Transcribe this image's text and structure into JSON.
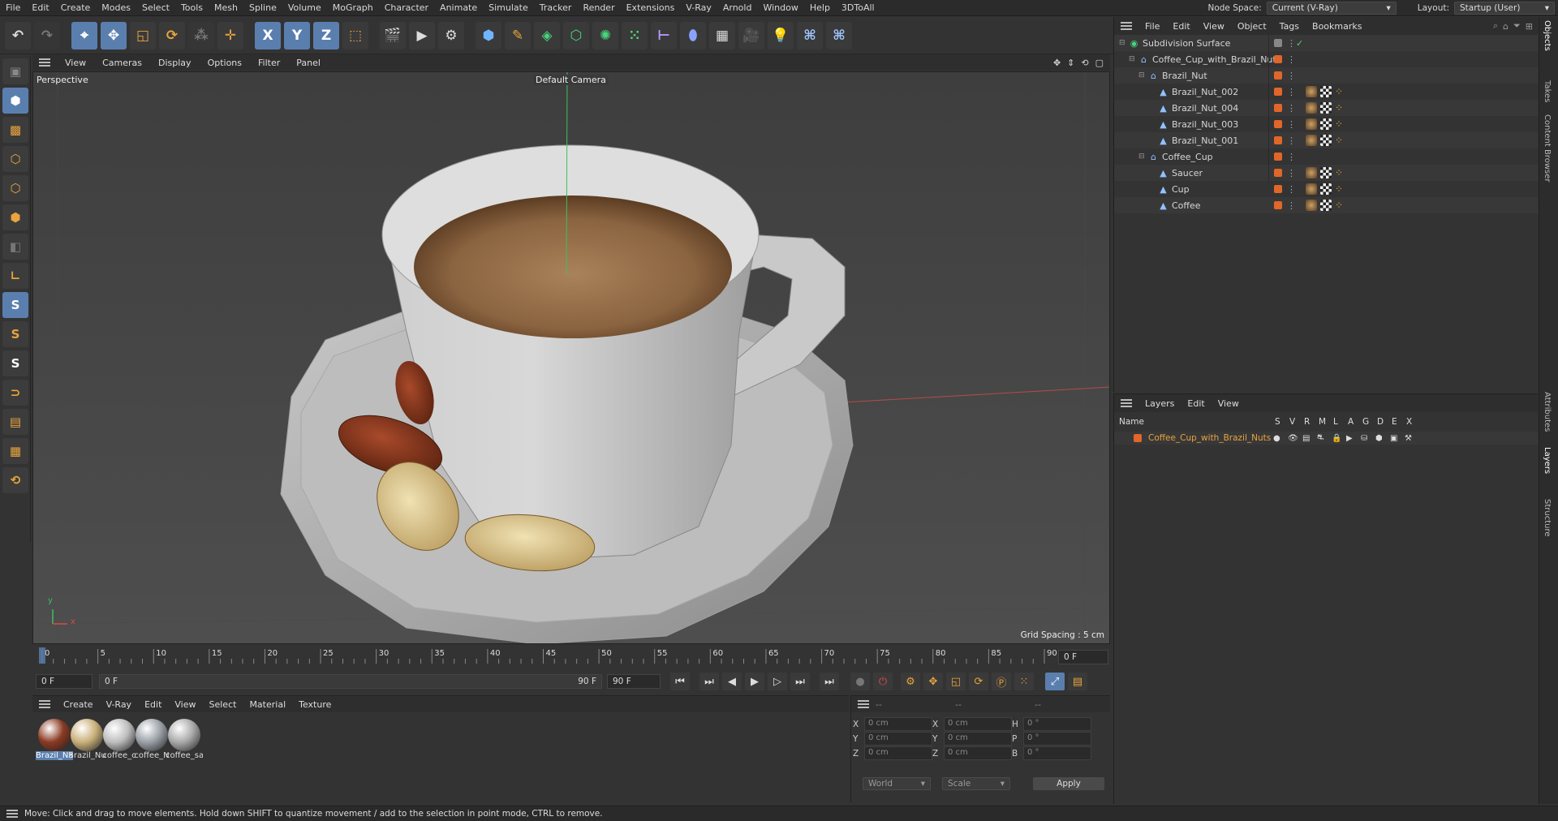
{
  "menubar": {
    "items": [
      "File",
      "Edit",
      "Create",
      "Modes",
      "Select",
      "Tools",
      "Mesh",
      "Spline",
      "Volume",
      "MoGraph",
      "Character",
      "Animate",
      "Simulate",
      "Tracker",
      "Render",
      "Extensions",
      "V-Ray",
      "Arnold",
      "Window",
      "Help",
      "3DToAll"
    ],
    "node_space_label": "Node Space:",
    "node_space_value": "Current (V-Ray)",
    "layout_label": "Layout:",
    "layout_value": "Startup (User)"
  },
  "toolbar": {
    "axis_x": "X",
    "axis_y": "Y",
    "axis_z": "Z"
  },
  "viewport": {
    "menu": [
      "View",
      "Cameras",
      "Display",
      "Options",
      "Filter",
      "Panel"
    ],
    "view_name": "Perspective",
    "camera": "Default Camera",
    "grid_spacing": "Grid Spacing : 5 cm",
    "axis_x_label": "x",
    "axis_y_label": "y"
  },
  "timeline": {
    "ticks": [
      "0",
      "5",
      "10",
      "15",
      "20",
      "25",
      "30",
      "35",
      "40",
      "45",
      "50",
      "55",
      "60",
      "65",
      "70",
      "75",
      "80",
      "85",
      "90"
    ],
    "current_frame": "0 F"
  },
  "playbar": {
    "start_field": "0 F",
    "range_start": "0 F",
    "range_end": "90 F",
    "end_field": "90 F"
  },
  "materials": {
    "menu": [
      "Create",
      "V-Ray",
      "Edit",
      "View",
      "Select",
      "Material",
      "Texture"
    ],
    "items": [
      {
        "name": "Brazil_Na",
        "color": "#8a3a22",
        "selected": true
      },
      {
        "name": "Brazil_Nu",
        "color": "#c9b07a",
        "selected": false
      },
      {
        "name": "coffee_c",
        "color": "#bdbdbd",
        "selected": false
      },
      {
        "name": "coffee_N",
        "color": "#9aa0a6",
        "selected": false
      },
      {
        "name": "coffee_sa",
        "color": "#a9a9a9",
        "selected": false
      }
    ]
  },
  "coordinates": {
    "headers": [
      "--",
      "--",
      "--"
    ],
    "rows": [
      {
        "l1": "X",
        "v1": "0 cm",
        "l2": "X",
        "v2": "0 cm",
        "l3": "H",
        "v3": "0 °"
      },
      {
        "l1": "Y",
        "v1": "0 cm",
        "l2": "Y",
        "v2": "0 cm",
        "l3": "P",
        "v3": "0 °"
      },
      {
        "l1": "Z",
        "v1": "0 cm",
        "l2": "Z",
        "v2": "0 cm",
        "l3": "B",
        "v3": "0 °"
      }
    ],
    "world": "World",
    "scale": "Scale",
    "apply": "Apply"
  },
  "objects": {
    "menu": [
      "File",
      "Edit",
      "View",
      "Object",
      "Tags",
      "Bookmarks"
    ],
    "rows": [
      {
        "name": "Subdivision Surface",
        "indent": 0,
        "icon": "subdivision-icon",
        "color": "#888888",
        "tags": 0
      },
      {
        "name": "Coffee_Cup_with_Brazil_Nuts",
        "indent": 1,
        "icon": "null-icon",
        "color": "#e0662a",
        "tags": 0
      },
      {
        "name": "Brazil_Nut",
        "indent": 2,
        "icon": "null-icon",
        "color": "#e0662a",
        "tags": 0
      },
      {
        "name": "Brazil_Nut_002",
        "indent": 3,
        "icon": "polygon-icon",
        "color": "#e0662a",
        "tags": 3
      },
      {
        "name": "Brazil_Nut_004",
        "indent": 3,
        "icon": "polygon-icon",
        "color": "#e0662a",
        "tags": 3
      },
      {
        "name": "Brazil_Nut_003",
        "indent": 3,
        "icon": "polygon-icon",
        "color": "#e0662a",
        "tags": 3
      },
      {
        "name": "Brazil_Nut_001",
        "indent": 3,
        "icon": "polygon-icon",
        "color": "#e0662a",
        "tags": 3
      },
      {
        "name": "Coffee_Cup",
        "indent": 2,
        "icon": "null-icon",
        "color": "#e0662a",
        "tags": 0
      },
      {
        "name": "Saucer",
        "indent": 3,
        "icon": "polygon-icon",
        "color": "#e0662a",
        "tags": 3
      },
      {
        "name": "Cup",
        "indent": 3,
        "icon": "polygon-icon",
        "color": "#e0662a",
        "tags": 3
      },
      {
        "name": "Coffee",
        "indent": 3,
        "icon": "polygon-icon",
        "color": "#e0662a",
        "tags": 3
      }
    ]
  },
  "layers": {
    "menu": [
      "Layers",
      "Edit",
      "View"
    ],
    "name_header": "Name",
    "flags": [
      "S",
      "V",
      "R",
      "M",
      "L",
      "A",
      "G",
      "D",
      "E",
      "X"
    ],
    "items": [
      {
        "name": "Coffee_Cup_with_Brazil_Nuts",
        "color": "#e0662a"
      }
    ]
  },
  "right_tabs": [
    "Objects",
    "Takes",
    "Content Browser",
    "Attributes",
    "Layers",
    "Structure"
  ],
  "status": "Move: Click and drag to move elements. Hold down SHIFT to quantize movement / add to the selection in point mode, CTRL to remove."
}
